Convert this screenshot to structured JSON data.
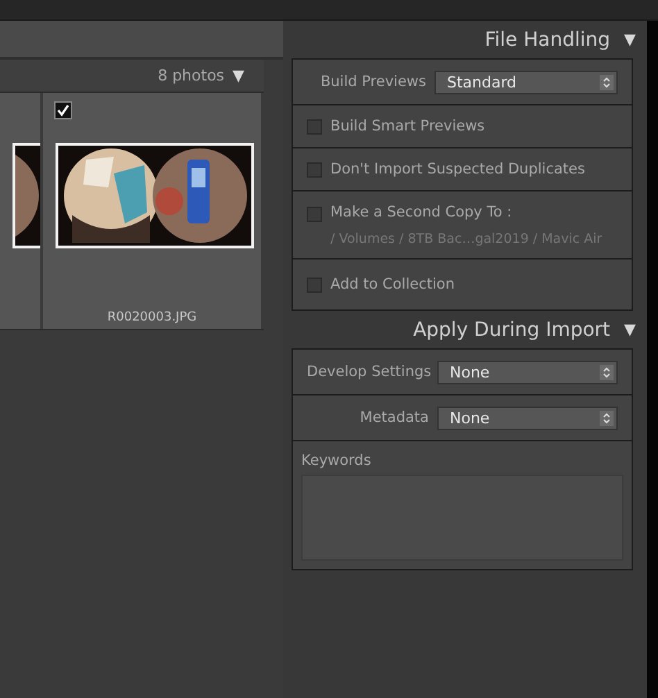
{
  "grid": {
    "count": "8 photos",
    "menu_toggle": "▼",
    "cells": [
      {
        "partial": true
      },
      {
        "partial": false,
        "checked": true,
        "filename": "R0020003.JPG"
      }
    ]
  },
  "sections": [
    {
      "title": "File Handling",
      "toggle": "▼",
      "rows": [
        {
          "kind": "select",
          "label": "Build Previews",
          "value": "Standard"
        },
        {
          "kind": "checkbox",
          "label": "Build Smart Previews",
          "checked": false
        },
        {
          "kind": "checkbox",
          "label": "Don't Import Suspected Duplicates",
          "checked": false
        },
        {
          "kind": "checkbox",
          "label": "Make a Second Copy To :",
          "checked": false,
          "path": "/ Volumes / 8TB Bac…gal2019 / Mavic Air"
        },
        {
          "kind": "checkbox",
          "label": "Add to Collection",
          "checked": false
        }
      ]
    },
    {
      "title": "Apply During Import",
      "toggle": "▼",
      "rows": [
        {
          "kind": "select",
          "label": "Develop Settings",
          "value": "None"
        },
        {
          "kind": "select",
          "label": "Metadata",
          "value": "None"
        },
        {
          "kind": "textarea",
          "label": "Keywords"
        }
      ]
    }
  ]
}
